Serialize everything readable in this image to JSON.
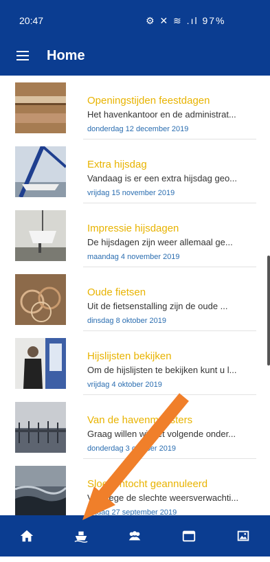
{
  "status_bar": {
    "time": "20:47",
    "icons": "⚙ ✕ ≋ .ıl",
    "battery": "97%"
  },
  "app_bar": {
    "title": "Home",
    "menu_icon": "hamburger-menu-icon"
  },
  "news": [
    {
      "title": "Openingstijden feestdagen",
      "summary": "Het havenkantoor en de administrat...",
      "date": "donderdag 12 december 2019",
      "thumb": "reeds"
    },
    {
      "title": "Extra hijsdag",
      "summary": "Vandaag is er een extra hijsdag geo...",
      "date": "vrijdag 15 november 2019",
      "thumb": "crane"
    },
    {
      "title": "Impressie hijsdagen",
      "summary": "De hijsdagen zijn weer allemaal ge...",
      "date": "maandag 4 november 2019",
      "thumb": "boat"
    },
    {
      "title": "Oude fietsen",
      "summary": " Uit de fietsenstalling zijn de oude ...",
      "date": "dinsdag 8 oktober 2019",
      "thumb": "bikes"
    },
    {
      "title": "Hijslijsten bekijken",
      "summary": "Om de hijslijsten te bekijken kunt u l...",
      "date": "vrijdag 4 oktober 2019",
      "thumb": "person"
    },
    {
      "title": "Van de havenmeesters",
      "summary": "Graag willen wij het volgende onder...",
      "date": "donderdag 3 oktober 2019",
      "thumb": "yard"
    },
    {
      "title": "Sloepentocht geannuleerd",
      "summary": "Vanwege de slechte weersverwachti...",
      "date": "vrijdag 27 september 2019",
      "thumb": "storm"
    }
  ],
  "bottom_nav": [
    {
      "name": "home-icon"
    },
    {
      "name": "boat-icon"
    },
    {
      "name": "people-icon"
    },
    {
      "name": "calendar-icon"
    },
    {
      "name": "gallery-icon"
    }
  ],
  "colors": {
    "primary": "#0b3d91",
    "title": "#e8b300",
    "date": "#2a6db0",
    "annotation_arrow": "#f07f2a"
  }
}
